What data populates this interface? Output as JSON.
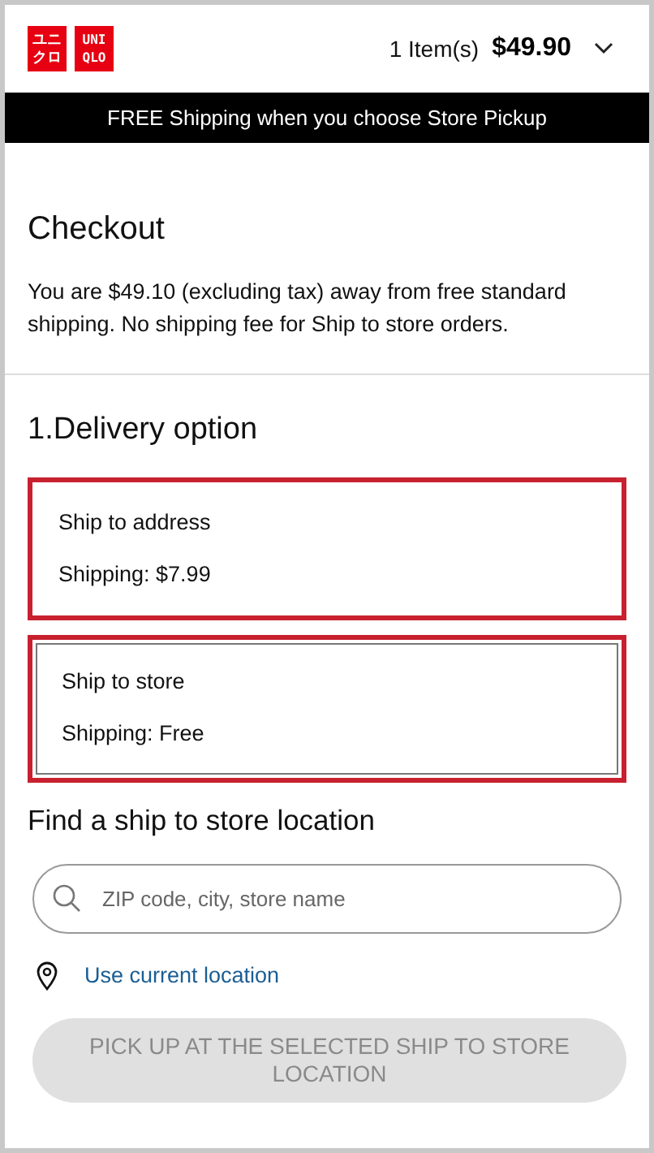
{
  "header": {
    "logo": [
      {
        "lines": [
          "ユニ",
          "クロ"
        ]
      },
      {
        "lines": [
          "UNI",
          "QLO"
        ]
      }
    ],
    "item_count": "1 Item(s)",
    "total": "$49.90"
  },
  "banner": "FREE Shipping when you choose Store Pickup",
  "checkout": {
    "title": "Checkout",
    "message": "You are $49.10 (excluding tax) away from free standard shipping. No shipping fee for Ship to store orders."
  },
  "delivery": {
    "title": "1.Delivery option",
    "options": [
      {
        "label": "Ship to address",
        "shipping": "Shipping: $7.99",
        "selected": false,
        "highlighted": true
      },
      {
        "label": "Ship to store",
        "shipping": "Shipping: Free",
        "selected": true,
        "highlighted": true
      }
    ]
  },
  "store_finder": {
    "title": "Find a ship to store location",
    "search": {
      "placeholder": "ZIP code, city, store name"
    },
    "location_link": "Use current location",
    "button": {
      "label": "PICK UP AT THE SELECTED SHIP TO STORE LOCATION",
      "disabled": true
    }
  }
}
